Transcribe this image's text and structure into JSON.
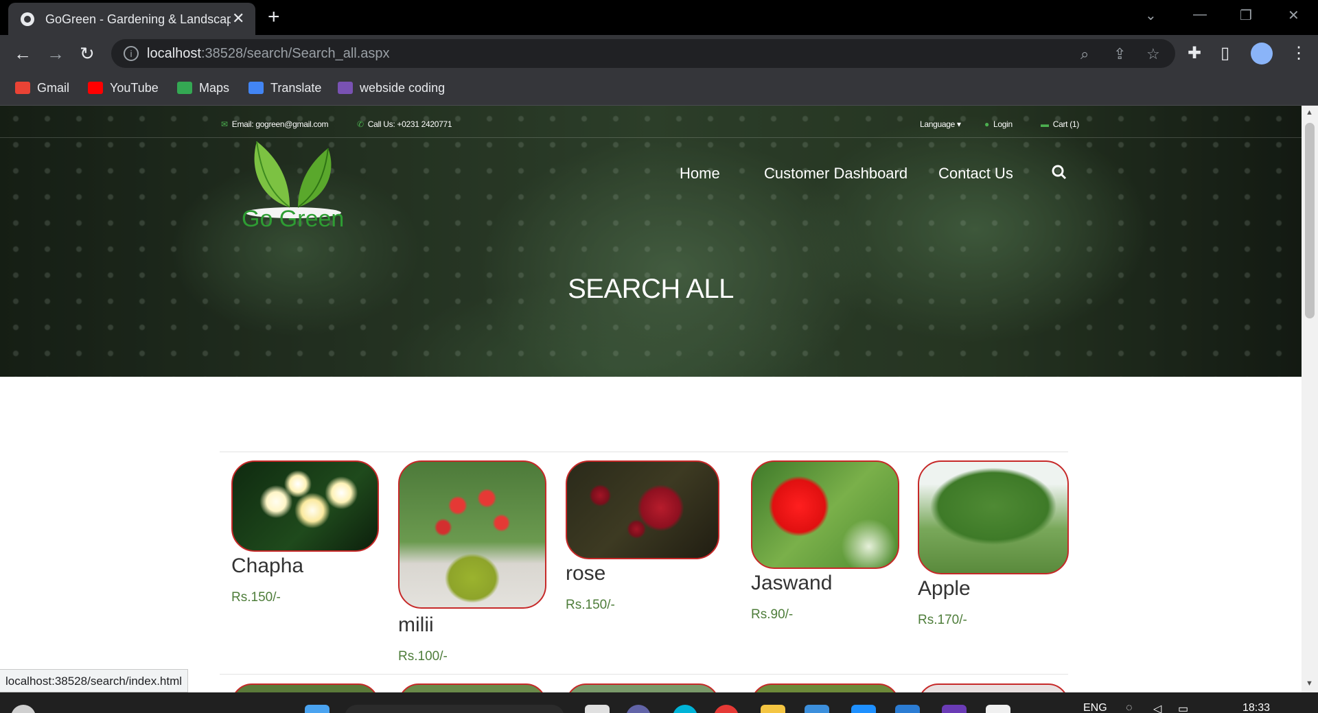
{
  "browser": {
    "tab_title": "GoGreen - Gardening & Landscap",
    "tab_close": "✕",
    "new_tab": "+",
    "url_host": "localhost",
    "url_rest": ":38528/search/Search_all.aspx",
    "bookmarks": [
      {
        "label": "Gmail",
        "color": "#ea4335"
      },
      {
        "label": "YouTube",
        "color": "#ff0000"
      },
      {
        "label": "Maps",
        "color": "#34a853"
      },
      {
        "label": "Translate",
        "color": "#4285f4"
      },
      {
        "label": "webside coding",
        "color": "#7952b3"
      }
    ]
  },
  "site": {
    "email": "Email: gogreen@gmail.com",
    "phone": "Call Us: +0231 2420771",
    "language": "Language ▾",
    "login": "Login",
    "cart": "Cart (1)",
    "logo_text": "Go Green",
    "nav": [
      "Home",
      "Customer Dashboard",
      "Contact Us"
    ],
    "page_heading": "SEARCH ALL",
    "brand_color": "#2e9d33",
    "accent_border": "#c62828"
  },
  "products": [
    {
      "name": "Chapha",
      "price": "Rs.150/-"
    },
    {
      "name": "milii",
      "price": "Rs.100/-"
    },
    {
      "name": "rose",
      "price": "Rs.150/-"
    },
    {
      "name": "Jaswand",
      "price": "Rs.90/-"
    },
    {
      "name": "Apple",
      "price": "Rs.170/-"
    }
  ],
  "status_url": "localhost:38528/search/index.html",
  "taskbar": {
    "language": "ENG",
    "time": "18:33"
  }
}
